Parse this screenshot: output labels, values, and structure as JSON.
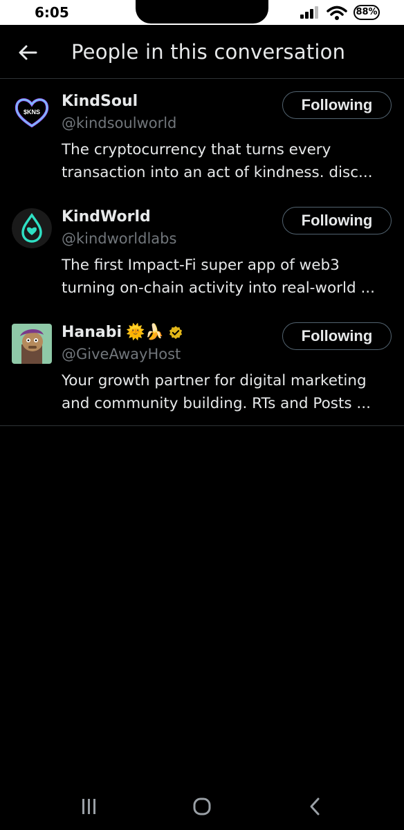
{
  "status_bar": {
    "time": "6:05",
    "battery": "88%",
    "icons": [
      "signal-icon",
      "wifi-icon",
      "battery-icon"
    ]
  },
  "header": {
    "title": "People in this conversation",
    "back_icon": "arrow-left-icon"
  },
  "people": [
    {
      "name": "KindSoul",
      "handle": "@kindsoulworld",
      "bio": "The cryptocurrency that turns every transaction into an act of kindness. disc...",
      "button": "Following",
      "avatar_text": "$KNS"
    },
    {
      "name": "KindWorld",
      "handle": "@kindworldlabs",
      "bio": "The first Impact-Fi super app of web3 turning on-chain activity into real-world ...",
      "button": "Following"
    },
    {
      "name": "Hanabi",
      "name_emojis": "🌞🍌",
      "handle": "@GiveAwayHost",
      "bio": "Your growth partner for digital marketing and community building. RTs and Posts ...",
      "button": "Following",
      "verified": true
    }
  ],
  "nav": {
    "icons": [
      "recent-apps-icon",
      "home-icon",
      "back-icon"
    ]
  },
  "colors": {
    "background": "#000000",
    "text": "#e7e9ea",
    "secondary": "#71767b",
    "divider": "#2f3336",
    "button_border": "#536471",
    "verified": "#e2b719"
  }
}
